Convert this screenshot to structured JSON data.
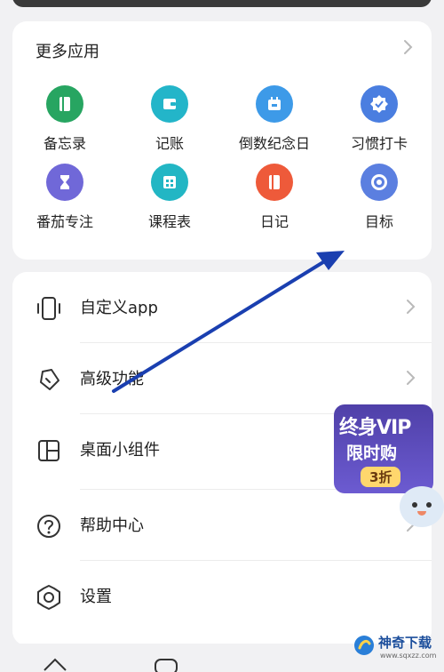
{
  "apps": {
    "header": "更多应用",
    "items": [
      {
        "label": "备忘录",
        "color": "#27a561",
        "icon": "notebook-icon"
      },
      {
        "label": "记账",
        "color": "#23b5c9",
        "icon": "wallet-icon"
      },
      {
        "label": "倒数纪念日",
        "color": "#3d9ae8",
        "icon": "calendar-icon"
      },
      {
        "label": "习惯打卡",
        "color": "#4a7ee0",
        "icon": "check-badge-icon"
      },
      {
        "label": "番茄专注",
        "color": "#7068d8",
        "icon": "hourglass-icon"
      },
      {
        "label": "课程表",
        "color": "#22b6c4",
        "icon": "timetable-icon"
      },
      {
        "label": "日记",
        "color": "#ee5a3a",
        "icon": "diary-icon"
      },
      {
        "label": "目标",
        "color": "#5b7fe0",
        "icon": "target-icon"
      }
    ]
  },
  "menu": {
    "items": [
      {
        "label": "自定义app",
        "icon": "phone-customize-icon",
        "chevron": true
      },
      {
        "label": "高级功能",
        "icon": "premium-tag-icon",
        "chevron": true
      },
      {
        "label": "桌面小组件",
        "icon": "widget-icon",
        "chevron": false
      },
      {
        "label": "帮助中心",
        "icon": "help-icon",
        "chevron": true
      },
      {
        "label": "设置",
        "icon": "settings-gear-icon",
        "chevron": false
      }
    ]
  },
  "promo": {
    "line1": "终身VIP",
    "line2": "限时购",
    "tag": "3折"
  },
  "watermark": {
    "name": "神奇下载",
    "url": "www.sqxzz.com"
  },
  "colors": {
    "annotation_arrow": "#1a3fb0"
  }
}
